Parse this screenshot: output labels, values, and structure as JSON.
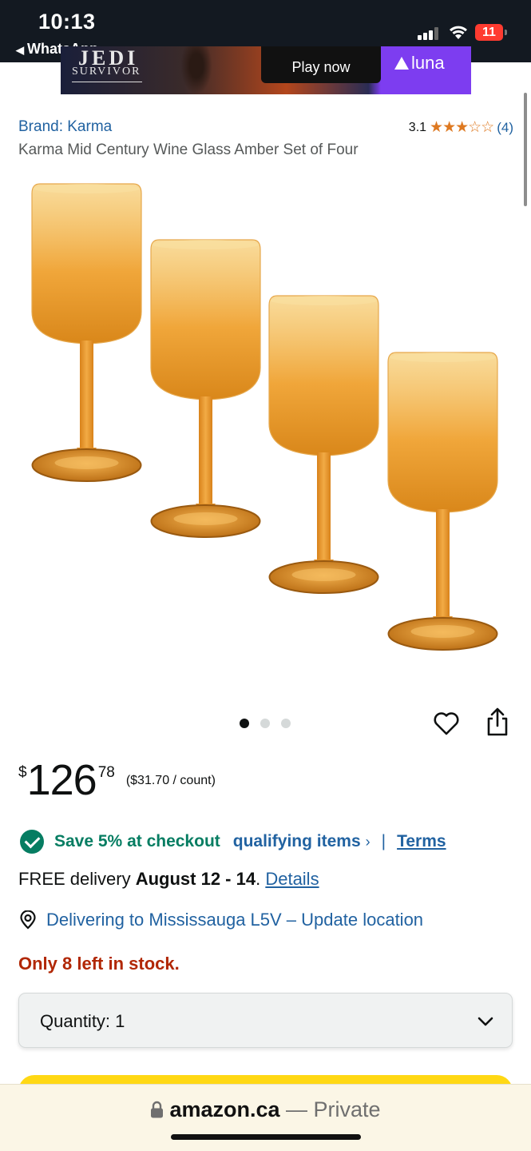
{
  "status_bar": {
    "time": "10:13",
    "back_app": "WhatsApp",
    "battery": "11",
    "icons": [
      "signal-icon",
      "wifi-icon",
      "battery-icon"
    ]
  },
  "ad": {
    "logo_top": "JEDI",
    "logo_sub": "SURVIVOR",
    "cta": "Play now",
    "service": "luna"
  },
  "product": {
    "brand": "Brand: Karma",
    "rating": "3.1",
    "stars": "★★★☆☆",
    "review_count": "(4)",
    "title": "Karma Mid Century Wine Glass Amber Set of Four",
    "image_count": 3,
    "active_image": 0
  },
  "price": {
    "symbol": "$",
    "whole": "126",
    "fraction": "78",
    "unit_price": "($31.70 / count)"
  },
  "promo": {
    "save_text": "Save 5% at checkout",
    "qualifying": "qualifying items",
    "chevron": "›",
    "separator": "|",
    "terms": "Terms"
  },
  "delivery": {
    "prefix": "FREE delivery ",
    "dates": "August 12 - 14",
    "period": ". ",
    "details": "Details"
  },
  "location": {
    "text": "Delivering to Mississauga L5V – Update location"
  },
  "stock": {
    "text": "Only 8 left in stock."
  },
  "quantity": {
    "label": "Quantity: 1"
  },
  "url_bar": {
    "host": "amazon.ca",
    "suffix": " — Private"
  },
  "colors": {
    "link": "#2162a1",
    "save_green": "#067d62",
    "stock_red": "#b12704",
    "star": "#de7921",
    "cart_yellow": "#ffd814"
  }
}
